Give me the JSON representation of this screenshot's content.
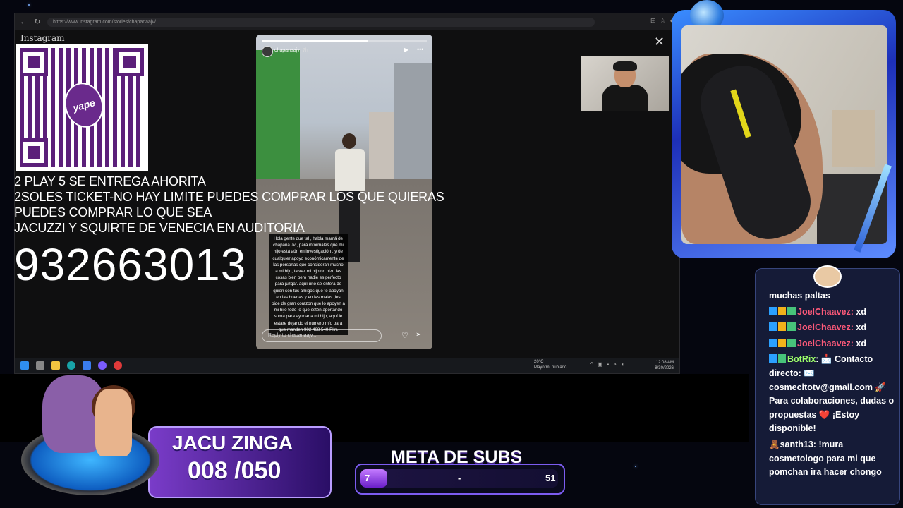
{
  "browser": {
    "url": "https://www.instagram.com/stories/chapanaajv/",
    "logo": "Instagram"
  },
  "story": {
    "username": "chapanaajv",
    "time": "7h",
    "caption": "Hola gente que tal , habla mamá de chapana Jv , para informales que mi hijo está aún en investigación , y de cualquier apoyo económicamente de las personas que consideran mucho a mi hijo, talvez mi hijo no hizo las cosas bien pero nadie es perfecto para juzgar. aquí uno se entera de quien son tus amigos que te apoyan en las buenas y en las malas ,les pide de gran corazon que lo apoyen a mi hijo todo lo que estén aportando suma para ayudar a mi hijo, aquí le estare dejando el número mío para que manden 902 468 540 Plin.",
    "reply_placeholder": "Reply to chapanaajv..."
  },
  "taskbar": {
    "weather_temp": "20°C",
    "weather_desc": "Mayorm. nublado",
    "time": "12:08 AM",
    "date": "8/30/2026"
  },
  "overlay": {
    "promo_lines": [
      "2 PLAY 5 SE ENTREGA AHORITA",
      "2SOLES TICKET-NO HAY LIMITE PUEDES COMPRAR LOS QUE QUIERAS",
      "PUEDES COMPRAR LO QUE SEA",
      "JACUZZI Y SQUIRTE DE VENECIA EN AUDITORIA"
    ],
    "phone": "932663013",
    "qr_brand": "yape"
  },
  "chat": {
    "messages": [
      {
        "user": "",
        "text": "muchas paltas"
      },
      {
        "user": "JoelChaavez",
        "text": "xd"
      },
      {
        "user": "JoelChaavez",
        "text": "xd"
      },
      {
        "user": "JoelChaavez",
        "text": "xd"
      },
      {
        "user": "BotRix",
        "text": "📩 Contacto directo: ✉️ cosmecitotv@gmail.com 🚀 Para colaboraciones, dudas o propuestas ❤️ ¡Estoy disponible!"
      },
      {
        "user": "",
        "text": "🧸santh13: !mura cosmetologo para mi que pomchan ira hacer chongo"
      }
    ]
  },
  "jacuzzi": {
    "title": "JACU ZINGA",
    "count": "008 /050"
  },
  "meta": {
    "title": "META DE SUBS",
    "current": "7",
    "separator": "-",
    "goal": "51",
    "progress_fraction": 0.137
  },
  "colors": {
    "chat_joel": "#ff5a7a",
    "chat_bot": "#9dff6a",
    "yape_purple": "#5b1f7a",
    "frame_blue": "#3a8dff"
  }
}
